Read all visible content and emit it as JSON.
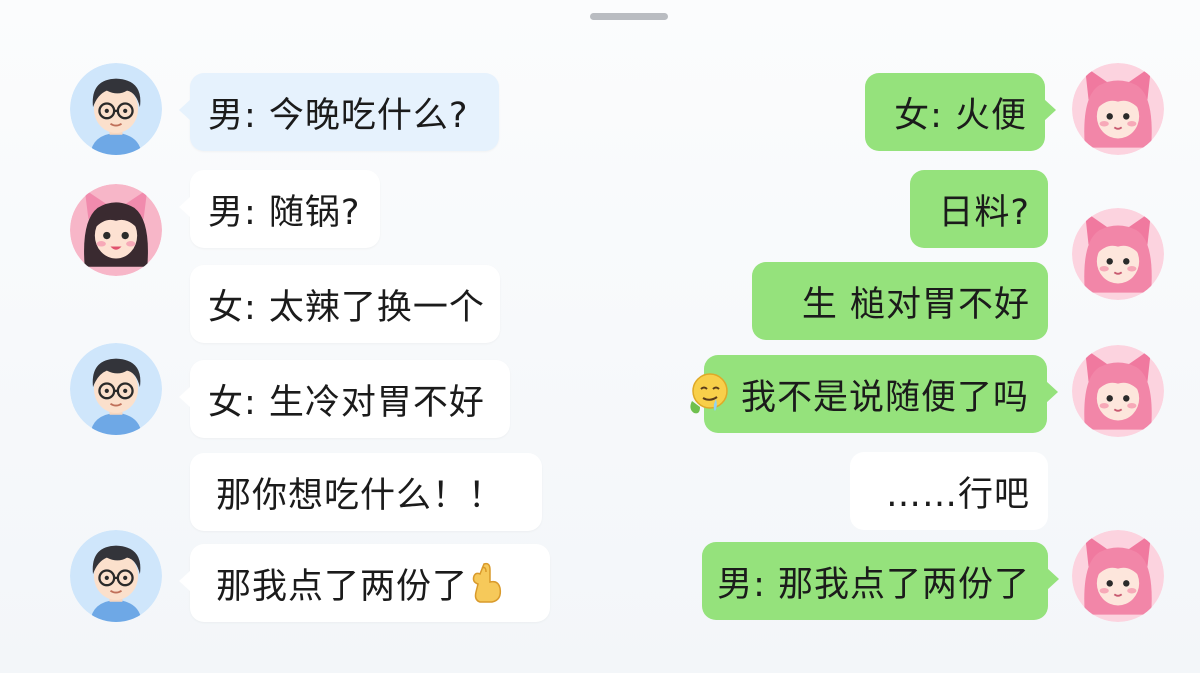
{
  "chat": {
    "left_messages": [
      {
        "text": "男: 今晚吃什么?"
      },
      {
        "text": "男: 随锅?"
      },
      {
        "text": "女: 太辣了换一个"
      },
      {
        "text": "女: 生冷对胃不好"
      },
      {
        "text": "那你想吃什么！！"
      },
      {
        "text": "那我点了两份了",
        "emoji": "finger-curl-emoji"
      }
    ],
    "right_messages": [
      {
        "text": "女: 火便"
      },
      {
        "text": "日料?"
      },
      {
        "text": "生 槌对胃不好"
      },
      {
        "text": "我不是说随便了吗",
        "emoji": "drooling-face-emoji"
      },
      {
        "text": "……行吧"
      },
      {
        "text": "男: 那我点了两份了"
      }
    ],
    "avatars": {
      "boy": "boy-avatar-glasses",
      "girl_dark_hair": "girl-avatar-dark-hair-cat-ears",
      "girl_pink_hair": "girl-avatar-pink-hair-cat-ears"
    },
    "colors": {
      "sent_bubble": "#95e27c",
      "received_bubble": "#ffffff",
      "tinted_bubble": "#e6f2fd"
    }
  }
}
